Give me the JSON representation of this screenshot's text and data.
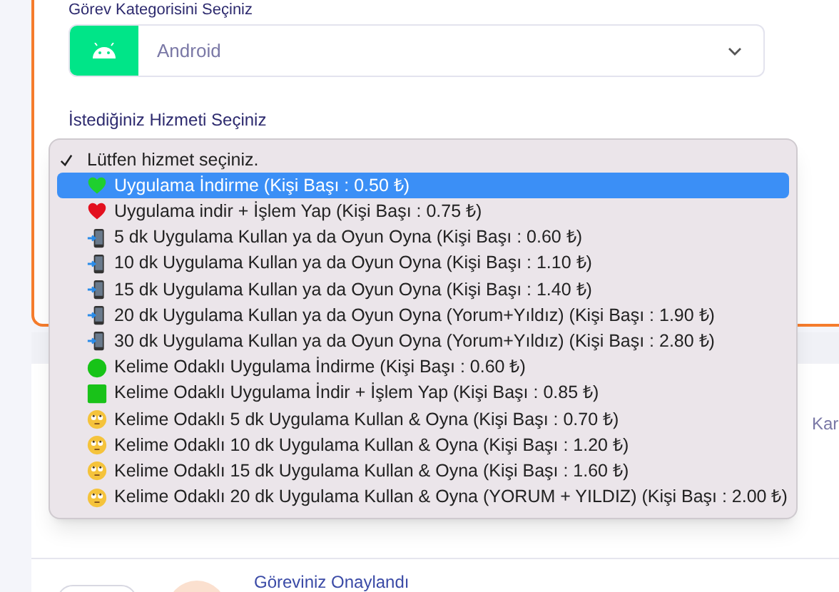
{
  "category_field": {
    "label": "Görev Kategorisini Seçiniz",
    "value": "Android"
  },
  "service_field": {
    "label": "İstediğiniz Hizmeti Seçiniz"
  },
  "service_menu": {
    "options": [
      {
        "kind": "plain",
        "label": "Lütfen hizmet seçiniz.",
        "checked": true,
        "highlighted": false
      },
      {
        "kind": "green-heart",
        "label": "Uygulama İndirme (Kişi Başı : 0.50 ₺)",
        "checked": false,
        "highlighted": true
      },
      {
        "kind": "red-heart",
        "label": "Uygulama indir + İşlem Yap (Kişi Başı : 0.75 ₺)",
        "checked": false,
        "highlighted": false
      },
      {
        "kind": "phone",
        "label": "5 dk Uygulama Kullan ya da Oyun Oyna (Kişi Başı : 0.60 ₺)",
        "checked": false,
        "highlighted": false
      },
      {
        "kind": "phone",
        "label": "10 dk Uygulama Kullan ya da Oyun Oyna (Kişi Başı : 1.10 ₺)",
        "checked": false,
        "highlighted": false
      },
      {
        "kind": "phone",
        "label": "15 dk Uygulama Kullan ya da Oyun Oyna (Kişi Başı : 1.40 ₺)",
        "checked": false,
        "highlighted": false
      },
      {
        "kind": "phone",
        "label": "20 dk Uygulama Kullan ya da Oyun Oyna (Yorum+Yıldız) (Kişi Başı : 1.90 ₺)",
        "checked": false,
        "highlighted": false
      },
      {
        "kind": "phone",
        "label": "30 dk Uygulama Kullan ya da Oyun Oyna (Yorum+Yıldız) (Kişi Başı : 2.80 ₺)",
        "checked": false,
        "highlighted": false
      },
      {
        "kind": "green-circle",
        "label": "Kelime Odaklı Uygulama İndirme (Kişi Başı : 0.60 ₺)",
        "checked": false,
        "highlighted": false
      },
      {
        "kind": "green-square",
        "label": "Kelime Odaklı Uygulama İndir + İşlem Yap (Kişi Başı : 0.85 ₺)",
        "checked": false,
        "highlighted": false
      },
      {
        "kind": "face",
        "label": "Kelime Odaklı 5 dk Uygulama Kullan & Oyna (Kişi Başı : 0.70 ₺)",
        "checked": false,
        "highlighted": false
      },
      {
        "kind": "face",
        "label": "Kelime Odaklı 10 dk Uygulama Kullan & Oyna (Kişi Başı : 1.20 ₺)",
        "checked": false,
        "highlighted": false
      },
      {
        "kind": "face",
        "label": "Kelime Odaklı 15 dk Uygulama Kullan & Oyna (Kişi Başı : 1.60 ₺)",
        "checked": false,
        "highlighted": false
      },
      {
        "kind": "face",
        "label": "Kelime Odaklı 20 dk Uygulama Kullan & Oyna (YORUM + YILDIZ) (Kişi Başı : 2.00 ₺)",
        "checked": false,
        "highlighted": false
      }
    ]
  },
  "side_text": "Kar",
  "notification": {
    "title": "Göreviniz Onaylandı"
  }
}
